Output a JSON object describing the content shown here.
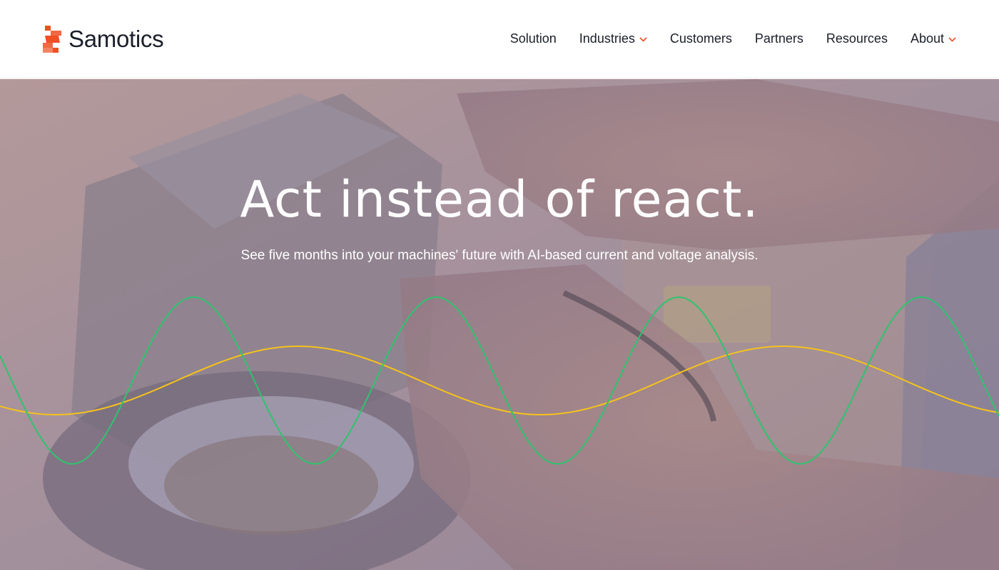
{
  "brand": {
    "name": "Samotics",
    "logo_icon": "samotics-s-logo-icon",
    "logo_color": "#f04e23"
  },
  "nav": {
    "items": [
      {
        "label": "Solution",
        "has_dropdown": false
      },
      {
        "label": "Industries",
        "has_dropdown": true,
        "icon": "chevron-down-icon"
      },
      {
        "label": "Customers",
        "has_dropdown": false
      },
      {
        "label": "Partners",
        "has_dropdown": false
      },
      {
        "label": "Resources",
        "has_dropdown": false
      },
      {
        "label": "About",
        "has_dropdown": true,
        "icon": "chevron-down-icon"
      }
    ],
    "chevron_color": "#f04e23",
    "text_color": "#1b1f2a"
  },
  "hero": {
    "title": "Act instead of react.",
    "subtitle": "See five months into your machines' future with AI-based current and voltage analysis.",
    "background_image": "electric-motor-repair-photo",
    "current_wave_color": "#2fc36f",
    "voltage_wave_color": "#f5c21b"
  }
}
